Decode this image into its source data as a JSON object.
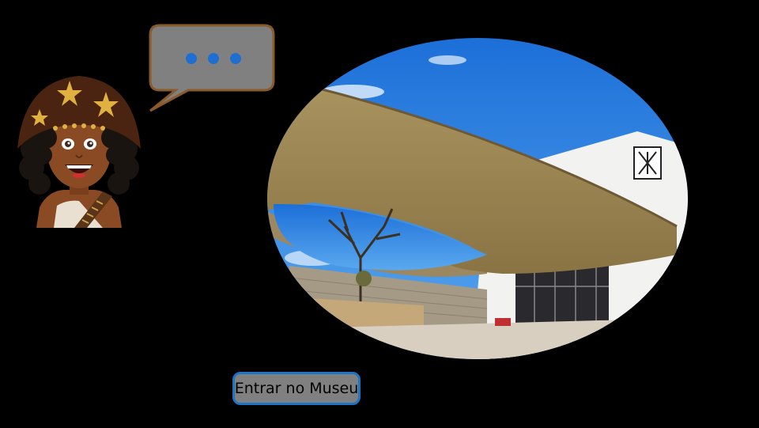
{
  "scene": {
    "background": "#000000"
  },
  "guide": {
    "icon": "guide-character-avatar",
    "speech_bubble": {
      "icon": "ellipsis-icon",
      "text": "•••",
      "fill": "#808080",
      "border": "#8a5a2b",
      "dot_color": "#1f6fd1"
    }
  },
  "photo": {
    "icon": "museum-building-photo",
    "shape": "oval"
  },
  "enter_button": {
    "label": "Entrar no Museu",
    "fill": "#808080",
    "border": "#1e74c4"
  }
}
